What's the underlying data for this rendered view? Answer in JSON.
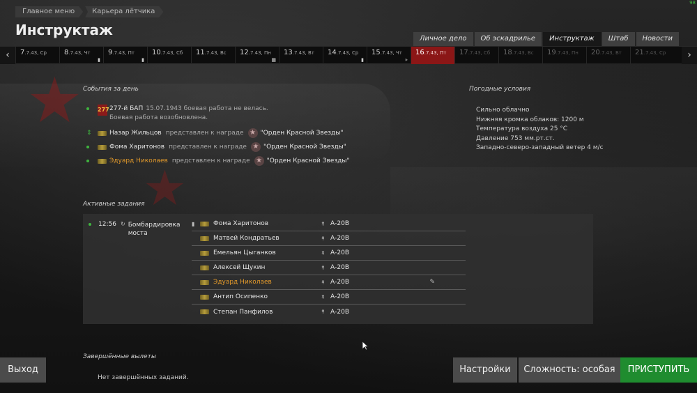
{
  "breadcrumbs": [
    "Главное меню",
    "Карьера лётчика"
  ],
  "page_title": "Инструктаж",
  "corner_counter": "98",
  "tabs": [
    {
      "label": "Личное дело",
      "active": false
    },
    {
      "label": "Об эскадрилье",
      "active": false
    },
    {
      "label": "Инструктаж",
      "active": true
    },
    {
      "label": "Штаб",
      "active": false
    },
    {
      "label": "Новости",
      "active": false
    }
  ],
  "dates": [
    {
      "num": "7",
      "rest": ".7.43, Ср",
      "state": "past",
      "marker": ""
    },
    {
      "num": "8",
      "rest": ".7.43, Чт",
      "state": "past",
      "marker": "▮"
    },
    {
      "num": "9",
      "rest": ".7.43, Пт",
      "state": "past",
      "marker": "▮"
    },
    {
      "num": "10",
      "rest": ".7.43, Сб",
      "state": "past",
      "marker": ""
    },
    {
      "num": "11",
      "rest": ".7.43, Вс",
      "state": "past",
      "marker": ""
    },
    {
      "num": "12",
      "rest": ".7.43, Пн",
      "state": "past",
      "marker": "▦"
    },
    {
      "num": "13",
      "rest": ".7.43, Вт",
      "state": "past",
      "marker": ""
    },
    {
      "num": "14",
      "rest": ".7.43, Ср",
      "state": "past",
      "marker": "▮"
    },
    {
      "num": "15",
      "rest": ".7.43, Чт",
      "state": "past",
      "marker": "»"
    },
    {
      "num": "16",
      "rest": ".7.43, Пт",
      "state": "today",
      "marker": ""
    },
    {
      "num": "17",
      "rest": ".7.43, Сб",
      "state": "future",
      "marker": ""
    },
    {
      "num": "18",
      "rest": ".7.43, Вс",
      "state": "future",
      "marker": ""
    },
    {
      "num": "19",
      "rest": ".7.43, Пн",
      "state": "future",
      "marker": ""
    },
    {
      "num": "20",
      "rest": ".7.43, Вт",
      "state": "future",
      "marker": ""
    },
    {
      "num": "21",
      "rest": ".7.43, Ср",
      "state": "future",
      "marker": ""
    }
  ],
  "events_header": "События за день",
  "unit_event": {
    "badge": "277",
    "title": "277-й БАП",
    "date": "15.07.1943",
    "line1": "боевая работа не велась.",
    "line2": "Боевая работа возобновлена."
  },
  "award_events": [
    {
      "name": "Назар Жильцов",
      "highlight": false,
      "sorting": true,
      "text": "представлен к награде",
      "award": "\"Орден Красной Звезды\""
    },
    {
      "name": "Фома Харитонов",
      "highlight": false,
      "sorting": false,
      "text": "представлен к награде",
      "award": "\"Орден Красной Звезды\""
    },
    {
      "name": "Эдуард Николаев",
      "highlight": true,
      "sorting": false,
      "text": "представлен к награде",
      "award": "\"Орден Красной Звезды\""
    }
  ],
  "weather_header": "Погодные условия",
  "weather": [
    "Сильно облачно",
    "Нижняя кромка облаков: 1200 м",
    "Температура воздуха 25 °C",
    "Давление 753 мм.рт.ст.",
    "Западно-северо-западный ветер 4 м/с"
  ],
  "tasks_header": "Активные задания",
  "task": {
    "time": "12:56",
    "name": "Бомбардировка моста",
    "crew": [
      {
        "name": "Фома Харитонов",
        "plane": "А-20В",
        "leader": true,
        "highlight": false,
        "editable": false
      },
      {
        "name": "Матвей Кондратьев",
        "plane": "А-20В",
        "leader": false,
        "highlight": false,
        "editable": false
      },
      {
        "name": "Емельян Цыганков",
        "plane": "А-20В",
        "leader": false,
        "highlight": false,
        "editable": false
      },
      {
        "name": "Алексей Щукин",
        "plane": "А-20В",
        "leader": false,
        "highlight": false,
        "editable": false
      },
      {
        "name": "Эдуард Николаев",
        "plane": "А-20В",
        "leader": false,
        "highlight": true,
        "editable": true
      },
      {
        "name": "Антип Осипенко",
        "plane": "А-20В",
        "leader": false,
        "highlight": false,
        "editable": false
      },
      {
        "name": "Степан Панфилов",
        "plane": "А-20В",
        "leader": false,
        "highlight": false,
        "editable": false
      }
    ]
  },
  "completed_header": "Завершённые вылеты",
  "completed_empty": "Нет завершённых заданий.",
  "buttons": {
    "exit": "Выход",
    "settings": "Настройки",
    "difficulty": "Сложность: особая",
    "start": "ПРИСТУПИТЬ"
  },
  "colors": {
    "accent_green": "#1f8c2f",
    "today_red": "#8b1616",
    "highlight_orange": "#e39a2b"
  }
}
